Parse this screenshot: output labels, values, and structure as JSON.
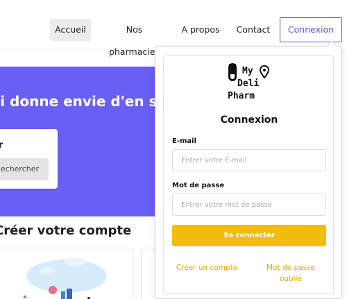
{
  "nav": {
    "items": [
      {
        "label": "Accueil",
        "active": true
      },
      {
        "label": "Nos pharmacies"
      },
      {
        "label": "A propos"
      },
      {
        "label": "Contact"
      }
    ],
    "login_label": "Connexion"
  },
  "hero": {
    "title": "ui donne envie d'en sav",
    "search_label": "r",
    "search_button": "echercher"
  },
  "section": {
    "title": "Créer votre compte"
  },
  "login": {
    "logo": {
      "line1": "My",
      "line2": "Deli",
      "line3": "Pharm",
      "icons": [
        "pill-icon",
        "map-pin-icon"
      ]
    },
    "title": "Connexion",
    "email_label": "E-mail",
    "email_placeholder": "Entrer votre E-mail",
    "email_value": "",
    "password_label": "Mot de passe",
    "password_placeholder": "Entrer votre mot de passe",
    "password_value": "",
    "submit_label": "Se connecter",
    "create_account": "Créer un compte",
    "forgot_password": "Mot de passe oublié"
  },
  "colors": {
    "accent": "#5a4fe0",
    "hero_bg": "#6a5ff5",
    "button": "#f2bd0c",
    "link": "#e0a800"
  }
}
